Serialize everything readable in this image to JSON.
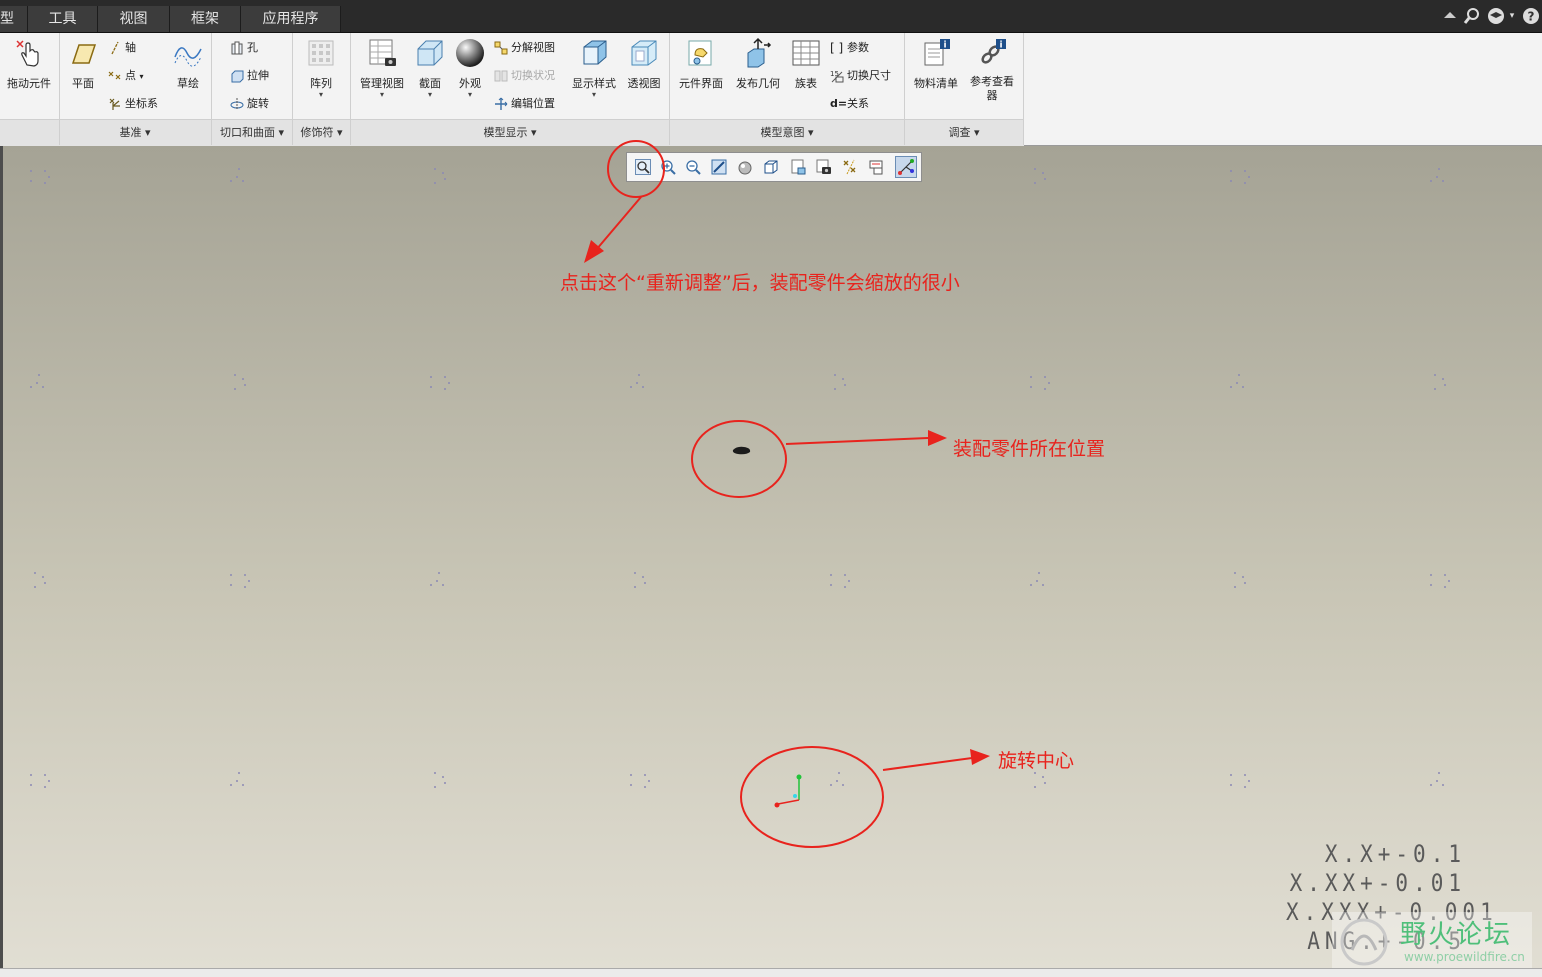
{
  "menu": {
    "partial_first": "型",
    "tabs": [
      "工具",
      "视图",
      "框架",
      "应用程序"
    ]
  },
  "top_icons": [
    "collapse-ribbon-icon",
    "search-icon",
    "learning-connector-icon",
    "help-icon"
  ],
  "ribbon": {
    "groups": {
      "datum": "基准",
      "cut_surface": "切口和曲面",
      "modifier": "修饰符",
      "model_display": "模型显示",
      "model_intent": "模型意图",
      "investigate": "调查"
    },
    "drag_component": "拖动元件",
    "plane": "平面",
    "axis": "轴",
    "point": "点",
    "csys": "坐标系",
    "sketch": "草绘",
    "hole": "孔",
    "extrude": "拉伸",
    "revolve": "旋转",
    "pattern": "阵列",
    "manage_views": "管理视图",
    "section": "截面",
    "appearance": "外观",
    "exploded_view": "分解视图",
    "toggle_status": "切换状况",
    "edit_position": "编辑位置",
    "display_style": "显示样式",
    "perspective": "透视图",
    "component_interface": "元件界面",
    "publish_geometry": "发布几何",
    "family_table": "族表",
    "parameters": "参数",
    "switch_dimensions": "切换尺寸",
    "relations": "关系",
    "bom": "物料清单",
    "reference_viewer": "参考查看器"
  },
  "annotations": {
    "refit": "点击这个“重新调整”后，装配零件会缩放的很小",
    "part_location": "装配零件所在位置",
    "spin_center": "旋转中心"
  },
  "tolerances": [
    "X.X+-0.1",
    "X.XX+-0.01",
    "X.XXX+-0.001",
    "ANG.+-0.5"
  ],
  "watermark": {
    "title": "野火论坛",
    "url": "www.proewildfire.cn"
  },
  "colors": {
    "annotation": "#e8231d",
    "menubar": "#2a2a2a",
    "ribbon": "#f3f3f3"
  }
}
